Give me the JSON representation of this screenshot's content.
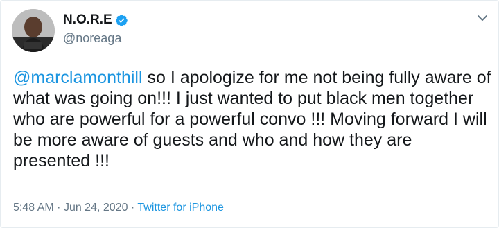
{
  "tweet": {
    "author": {
      "display_name": "N.O.R.E",
      "handle": "@noreaga",
      "verified": true,
      "avatar_icon": "profile-photo"
    },
    "menu_icon": "chevron-down-icon",
    "mention": "@marclamonthill",
    "body": " so I apologize for me not being fully aware of what was going on!!! I just wanted to put black men together who are powerful for a powerful convo !!! Moving forward I will be more aware of guests and who and how they are presented !!!",
    "time": "5:48 AM",
    "separator": "·",
    "date": "Jun 24, 2020",
    "source": "Twitter for iPhone",
    "colors": {
      "link": "#1b95e0",
      "muted": "#657786",
      "text": "#14171a",
      "verified": "#1da1f2"
    }
  }
}
